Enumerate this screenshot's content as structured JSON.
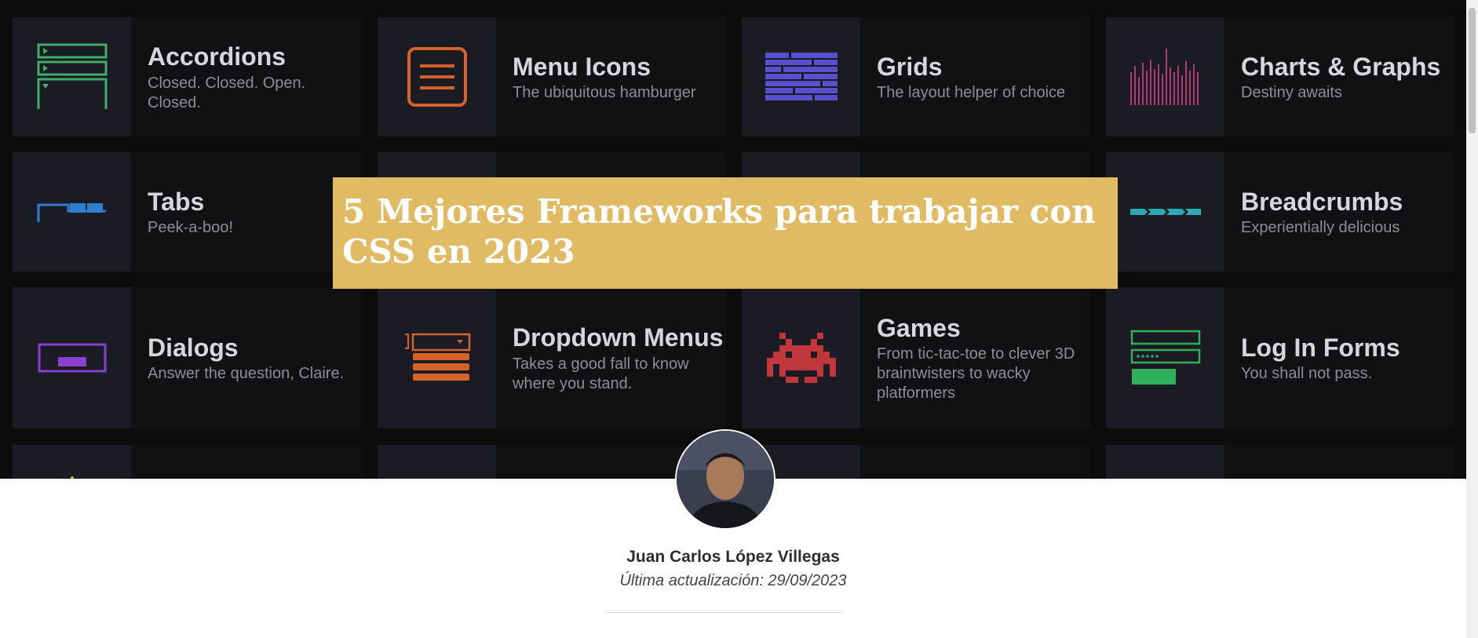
{
  "hero": {
    "cards": [
      {
        "title": "Accordions",
        "subtitle": "Closed. Closed. Open. Closed.",
        "icon": "accordion-icon",
        "color": "#3fae6a"
      },
      {
        "title": "Menu Icons",
        "subtitle": "The ubiquitous hamburger",
        "icon": "hamburger-icon",
        "color": "#d4622a"
      },
      {
        "title": "Grids",
        "subtitle": "The layout helper of choice",
        "icon": "grid-icon",
        "color": "#5a4fcf"
      },
      {
        "title": "Charts & Graphs",
        "subtitle": "Destiny awaits",
        "icon": "bar-chart-icon",
        "color": "#b03a78"
      },
      {
        "title": "Tabs",
        "subtitle": "Peek-a-boo!",
        "icon": "tabs-icon",
        "color": "#2f7fd1"
      },
      {
        "title": "Breadcrumbs",
        "subtitle": "Experientially delicious",
        "icon": "breadcrumbs-icon",
        "color": "#2aa9b0"
      },
      {
        "title": "Dialogs",
        "subtitle": "Answer the question, Claire.",
        "icon": "dialog-icon",
        "color": "#8a3fcf"
      },
      {
        "title": "Dropdown Menus",
        "subtitle": "Takes a good fall to know where you stand.",
        "icon": "dropdown-icon",
        "color": "#d4622a"
      },
      {
        "title": "Games",
        "subtitle": "From tic-tac-toe to clever 3D braintwisters to wacky platformers",
        "icon": "space-invader-icon",
        "color": "#c0363a"
      },
      {
        "title": "Log In Forms",
        "subtitle": "You shall not pass.",
        "icon": "login-form-icon",
        "color": "#2fae5c"
      },
      {
        "title": "",
        "subtitle": "",
        "icon": "loader-icon",
        "color": "#c8b23a"
      },
      {
        "title": "",
        "subtitle": "",
        "icon": "",
        "color": ""
      },
      {
        "title": "",
        "subtitle": "",
        "icon": "",
        "color": ""
      },
      {
        "title": "",
        "subtitle": "",
        "icon": "",
        "color": ""
      }
    ]
  },
  "article": {
    "title": "5 Mejores Frameworks para trabajar con CSS en 2023"
  },
  "author": {
    "name": "Juan Carlos López Villegas",
    "updated": "Última actualización: 29/09/2023",
    "avatar_icon": "avatar"
  },
  "colors": {
    "accent": "#e1bb64",
    "hero_bg": "#0c0c0d"
  }
}
